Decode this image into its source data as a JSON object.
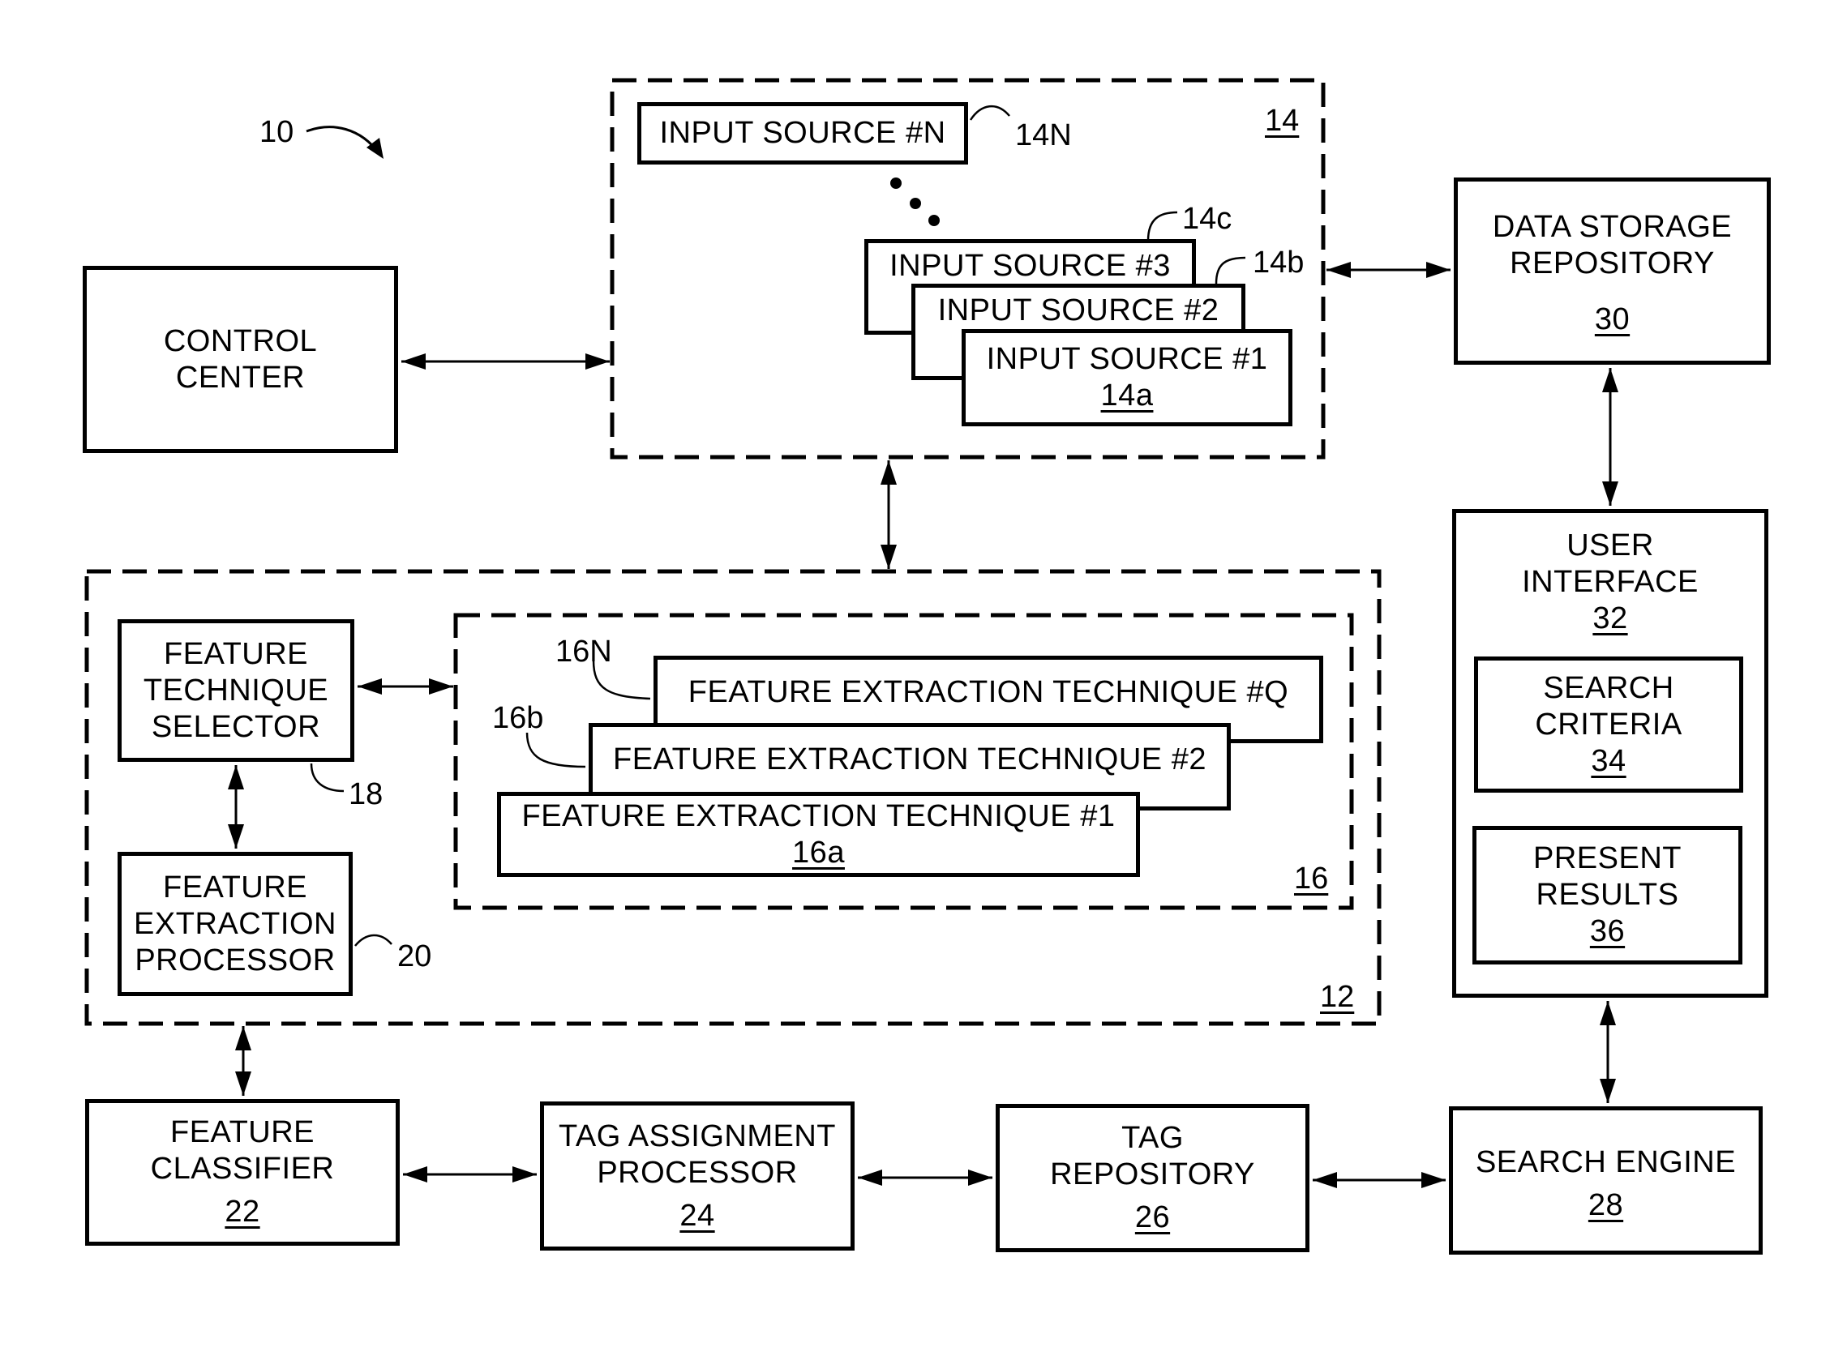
{
  "figure": {
    "system_ref": "10",
    "control_center": {
      "lines": [
        "CONTROL",
        "CENTER"
      ]
    },
    "input_group": {
      "ref": "14",
      "sources": [
        {
          "label": "INPUT SOURCE #N",
          "ref": "14N"
        },
        {
          "label": "INPUT SOURCE #3",
          "ref": "14c"
        },
        {
          "label": "INPUT SOURCE #2",
          "ref": "14b"
        },
        {
          "label": "INPUT SOURCE #1",
          "ref": "14a"
        }
      ]
    },
    "data_storage": {
      "lines": [
        "DATA STORAGE",
        "REPOSITORY"
      ],
      "ref": "30"
    },
    "user_interface": {
      "lines": [
        "USER",
        "INTERFACE"
      ],
      "ref": "32",
      "search_criteria": {
        "lines": [
          "SEARCH",
          "CRITERIA"
        ],
        "ref": "34"
      },
      "present_results": {
        "lines": [
          "PRESENT",
          "RESULTS"
        ],
        "ref": "36"
      }
    },
    "processing_group": {
      "ref": "12",
      "technique_selector": {
        "lines": [
          "FEATURE",
          "TECHNIQUE",
          "SELECTOR"
        ],
        "ref": "18"
      },
      "extraction_processor": {
        "lines": [
          "FEATURE",
          "EXTRACTION",
          "PROCESSOR"
        ],
        "ref": "20"
      },
      "techniques_group": {
        "ref": "16",
        "techniques": [
          {
            "label": "FEATURE EXTRACTION TECHNIQUE #Q",
            "ref": "16N"
          },
          {
            "label": "FEATURE EXTRACTION TECHNIQUE #2",
            "ref": "16b"
          },
          {
            "label": "FEATURE EXTRACTION TECHNIQUE #1",
            "ref": "16a"
          }
        ]
      }
    },
    "feature_classifier": {
      "lines": [
        "FEATURE",
        "CLASSIFIER"
      ],
      "ref": "22"
    },
    "tag_assignment": {
      "lines": [
        "TAG ASSIGNMENT",
        "PROCESSOR"
      ],
      "ref": "24"
    },
    "tag_repository": {
      "lines": [
        "TAG",
        "REPOSITORY"
      ],
      "ref": "26"
    },
    "search_engine": {
      "lines": [
        "SEARCH ENGINE"
      ],
      "ref": "28"
    }
  }
}
